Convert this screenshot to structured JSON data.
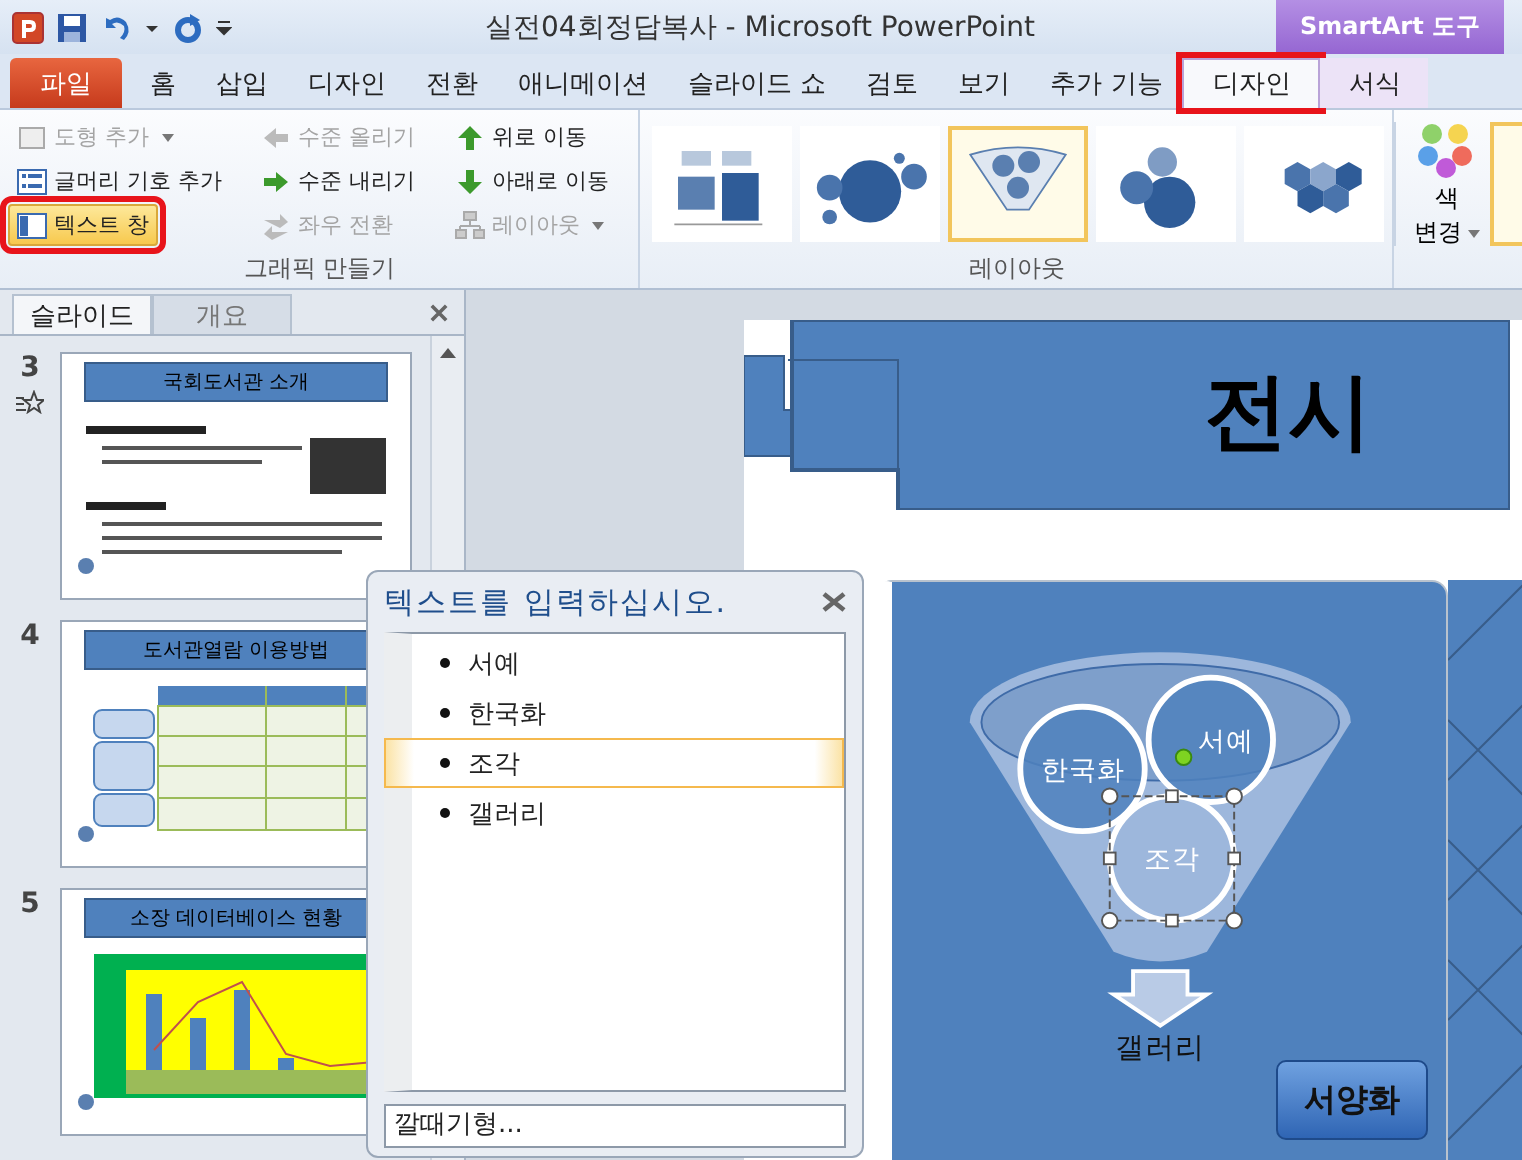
{
  "title_bar": {
    "title": "실전04회정답복사 - Microsoft PowerPoint",
    "context_label": "SmartArt 도구"
  },
  "tabs": [
    {
      "label": "파일",
      "kind": "file",
      "selected": false,
      "annotated": false
    },
    {
      "label": "홈",
      "kind": "main",
      "selected": false,
      "annotated": false
    },
    {
      "label": "삽입",
      "kind": "main",
      "selected": false,
      "annotated": false
    },
    {
      "label": "디자인",
      "kind": "main",
      "selected": false,
      "annotated": false
    },
    {
      "label": "전환",
      "kind": "main",
      "selected": false,
      "annotated": false
    },
    {
      "label": "애니메이션",
      "kind": "main",
      "selected": false,
      "annotated": false
    },
    {
      "label": "슬라이드 쇼",
      "kind": "main",
      "selected": false,
      "annotated": false
    },
    {
      "label": "검토",
      "kind": "main",
      "selected": false,
      "annotated": false
    },
    {
      "label": "보기",
      "kind": "main",
      "selected": false,
      "annotated": false
    },
    {
      "label": "추가 기능",
      "kind": "main",
      "selected": false,
      "annotated": false
    },
    {
      "label": "디자인",
      "kind": "context",
      "selected": true,
      "annotated": true
    },
    {
      "label": "서식",
      "kind": "context",
      "selected": false,
      "annotated": false
    }
  ],
  "ribbon": {
    "create_graphic": {
      "label": "그래픽 만들기",
      "commands": [
        {
          "label": "도형 추가",
          "disabled": true,
          "dropdown": true,
          "selected": false,
          "annotated": false
        },
        {
          "label": "글머리 기호 추가",
          "disabled": false,
          "dropdown": false,
          "selected": false,
          "annotated": false
        },
        {
          "label": "텍스트 창",
          "disabled": false,
          "dropdown": false,
          "selected": true,
          "annotated": true
        },
        {
          "label": "수준 올리기",
          "disabled": true,
          "dropdown": false,
          "selected": false,
          "annotated": false
        },
        {
          "label": "수준 내리기",
          "disabled": false,
          "dropdown": false,
          "selected": false,
          "annotated": false
        },
        {
          "label": "좌우 전환",
          "disabled": true,
          "dropdown": false,
          "selected": false,
          "annotated": false
        },
        {
          "label": "위로 이동",
          "disabled": false,
          "dropdown": false,
          "selected": false,
          "annotated": false
        },
        {
          "label": "아래로 이동",
          "disabled": false,
          "dropdown": false,
          "selected": false,
          "annotated": false
        },
        {
          "label": "레이아웃",
          "disabled": true,
          "dropdown": true,
          "selected": false,
          "annotated": false
        }
      ]
    },
    "layouts": {
      "label": "레이아웃",
      "items": [
        {
          "selected": false
        },
        {
          "selected": false
        },
        {
          "selected": true
        },
        {
          "selected": false
        },
        {
          "selected": false
        }
      ]
    },
    "change_colors": {
      "label_lines": [
        "색",
        "변경"
      ],
      "dropdown": true
    }
  },
  "slide_pane": {
    "tabs": [
      {
        "label": "슬라이드",
        "selected": true
      },
      {
        "label": "개요",
        "selected": false
      }
    ],
    "slides": [
      {
        "number": "3",
        "title": "국회도서관 소개",
        "kind": "text",
        "has_animation": true
      },
      {
        "number": "4",
        "title": "도서관열람 이용방법",
        "kind": "table",
        "has_animation": false
      },
      {
        "number": "5",
        "title": "소장 데이터베이스 현황",
        "kind": "chart",
        "has_animation": false
      }
    ]
  },
  "text_pane": {
    "title": "텍스트를 입력하십시오.",
    "items": [
      {
        "text": "서예",
        "selected": false
      },
      {
        "text": "한국화",
        "selected": false
      },
      {
        "text": "조각",
        "selected": true
      },
      {
        "text": "갤러리",
        "selected": false
      }
    ],
    "layout_name": "깔때기형..."
  },
  "slide": {
    "title": "전시",
    "smartart": {
      "funnel_items": [
        {
          "text": "한국화",
          "selected": false
        },
        {
          "text": "서예",
          "selected": false
        },
        {
          "text": "조각",
          "selected": true
        }
      ],
      "result": "갤러리"
    },
    "shape_label": "서양화"
  }
}
